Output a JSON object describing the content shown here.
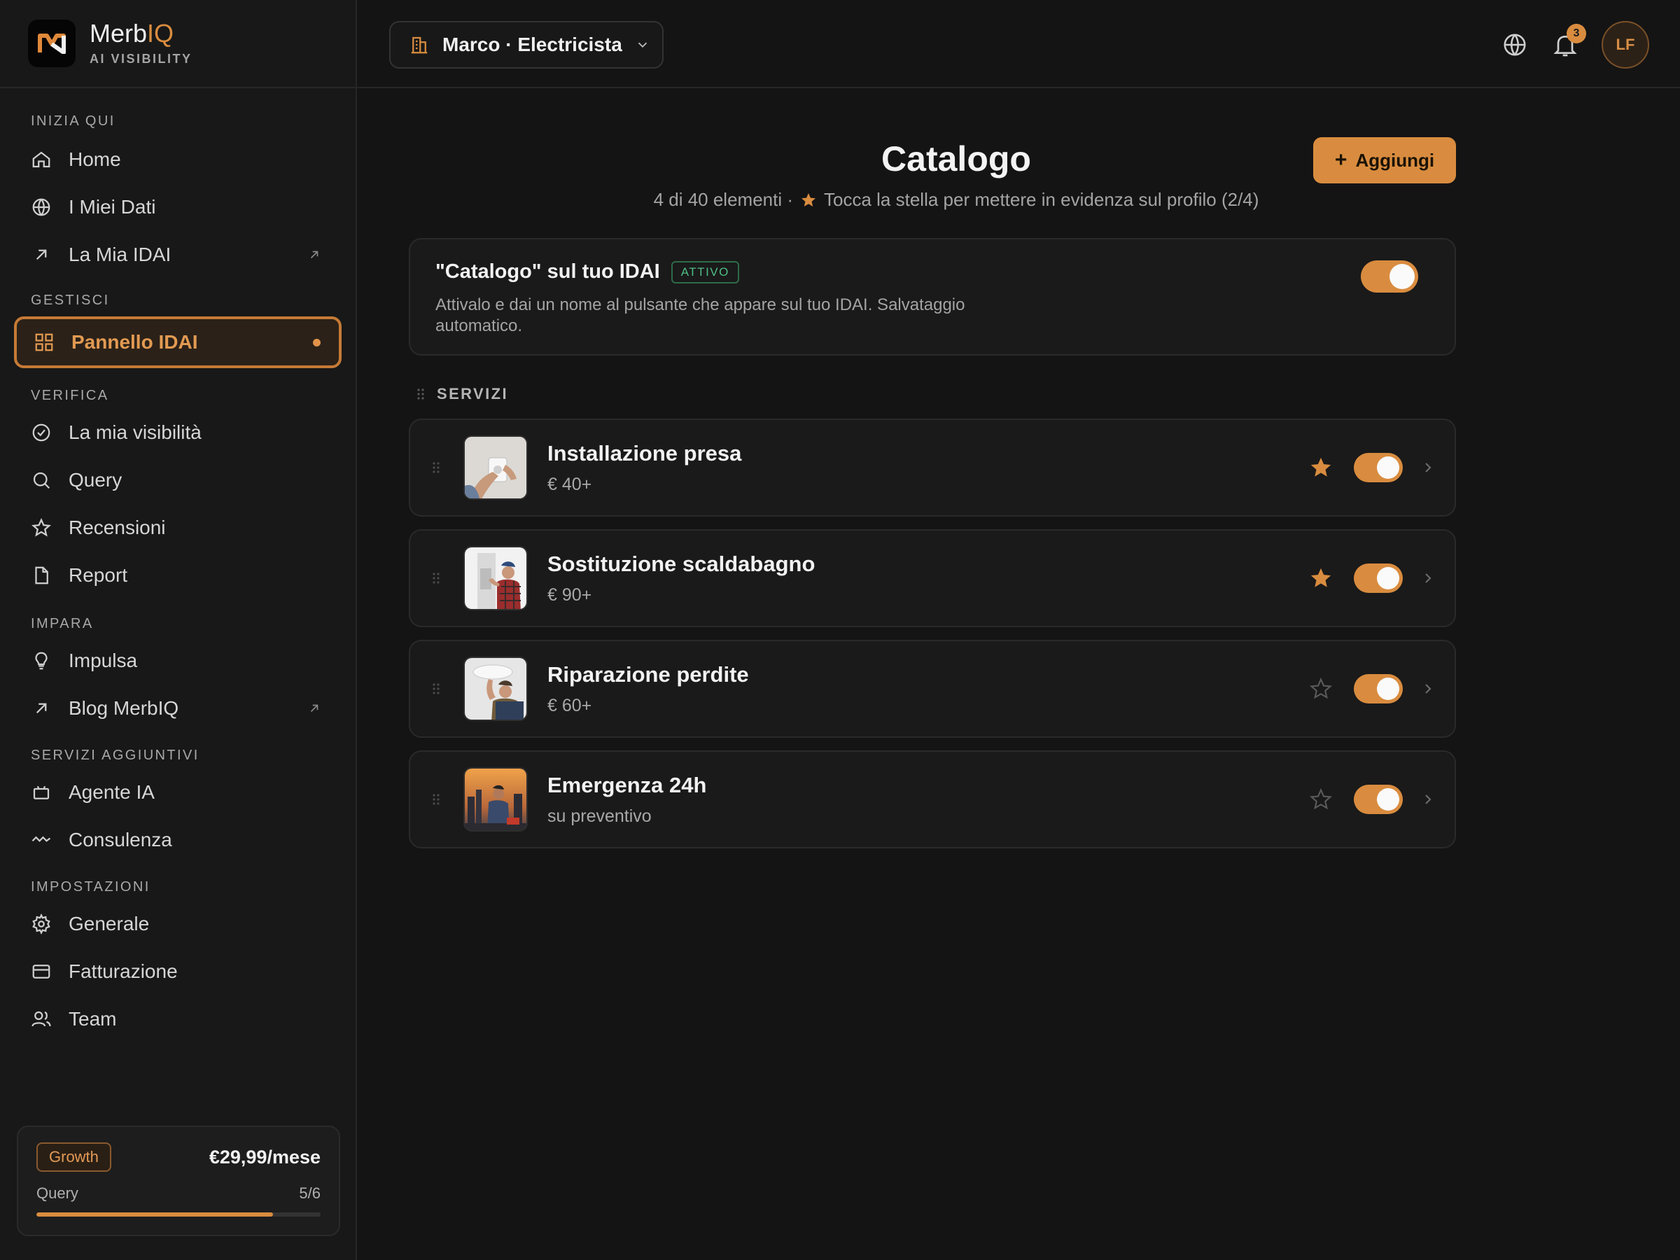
{
  "brand": {
    "name_prefix": "Merb",
    "name_accent": "IQ",
    "tagline": "AI VISIBILITY"
  },
  "sidebar": {
    "sections": [
      {
        "label": "INIZIA QUI",
        "items": [
          {
            "label": "Home",
            "icon": "home-icon"
          },
          {
            "label": "I Miei Dati",
            "icon": "globe-icon"
          },
          {
            "label": "La Mia IDAI",
            "icon": "arrow-up-right-icon",
            "external": true
          }
        ]
      },
      {
        "label": "GESTISCI",
        "items": [
          {
            "label": "Pannello IDAI",
            "icon": "grid-icon",
            "active": true
          }
        ]
      },
      {
        "label": "VERIFICA",
        "items": [
          {
            "label": "La mia visibilità",
            "icon": "check-circle-icon"
          },
          {
            "label": "Query",
            "icon": "search-icon"
          },
          {
            "label": "Recensioni",
            "icon": "star-icon"
          },
          {
            "label": "Report",
            "icon": "document-icon"
          }
        ]
      },
      {
        "label": "IMPARA",
        "items": [
          {
            "label": "Impulsa",
            "icon": "lightbulb-icon"
          },
          {
            "label": "Blog MerbIQ",
            "icon": "arrow-up-right-icon",
            "external": true
          }
        ]
      },
      {
        "label": "SERVIZI AGGIUNTIVI",
        "items": [
          {
            "label": "Agente IA",
            "icon": "robot-icon"
          },
          {
            "label": "Consulenza",
            "icon": "activity-icon"
          }
        ]
      },
      {
        "label": "IMPOSTAZIONI",
        "items": [
          {
            "label": "Generale",
            "icon": "gear-icon"
          },
          {
            "label": "Fatturazione",
            "icon": "credit-card-icon"
          },
          {
            "label": "Team",
            "icon": "users-icon"
          }
        ]
      }
    ],
    "plan": {
      "name": "Growth",
      "price": "€29,99/mese",
      "usage_label": "Query",
      "usage_text": "5/6",
      "usage_fraction": 0.833
    }
  },
  "topbar": {
    "business": "Marco · Electricista",
    "notifications_count": "3",
    "avatar_initials": "LF"
  },
  "catalog": {
    "title": "Catalogo",
    "subtitle_count": "4 di 40 elementi ·",
    "subtitle_hint": "Tocca la stella per mettere in evidenza sul profilo (2/4)",
    "add_label": "Aggiungi",
    "feature": {
      "title": "\"Catalogo\" sul tuo IDAI",
      "status": "ATTIVO",
      "description": "Attivalo e dai un nome al pulsante che appare sul tuo IDAI. Salvataggio automatico.",
      "enabled": true
    },
    "section_label": "SERVIZI",
    "services": [
      {
        "name": "Installazione presa",
        "price": "€ 40+",
        "featured": true,
        "enabled": true
      },
      {
        "name": "Sostituzione scaldabagno",
        "price": "€ 90+",
        "featured": true,
        "enabled": true
      },
      {
        "name": "Riparazione perdite",
        "price": "€ 60+",
        "featured": false,
        "enabled": true
      },
      {
        "name": "Emergenza 24h",
        "price": "su preventivo",
        "featured": false,
        "enabled": true
      }
    ]
  },
  "colors": {
    "accent": "#d98c3f",
    "background": "#141414",
    "sidebar": "#181818",
    "status_green": "#4fbf86"
  }
}
